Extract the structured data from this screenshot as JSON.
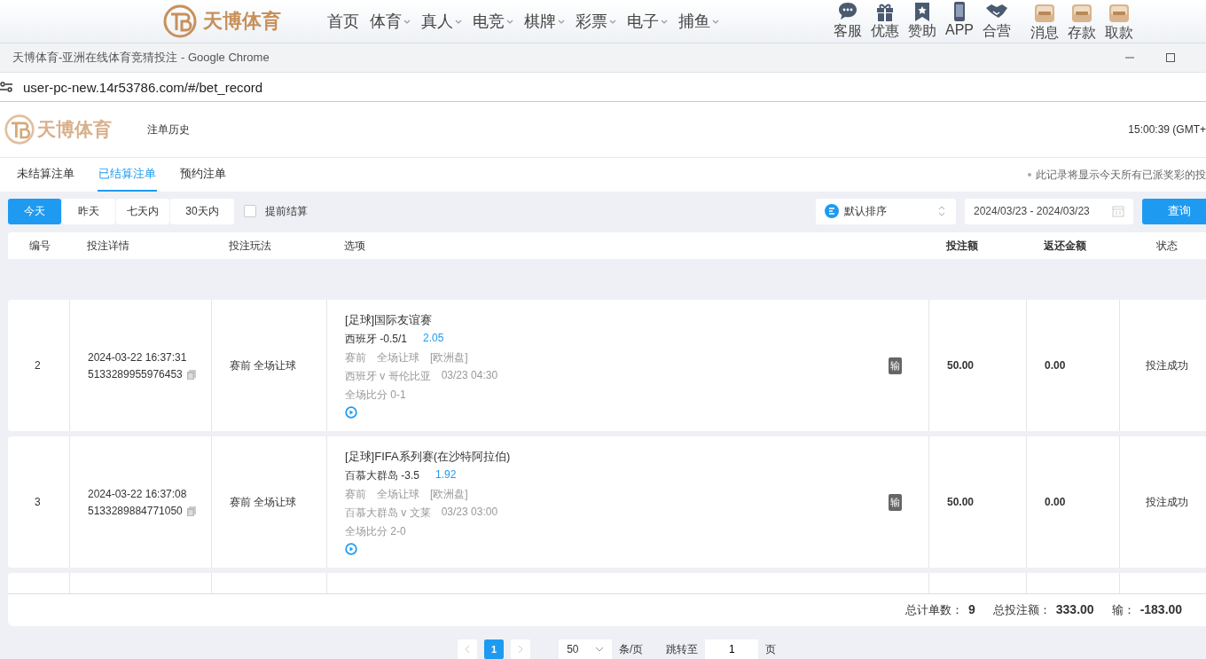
{
  "site_nav": {
    "brand": "天博体育",
    "menu": [
      {
        "label": "首页",
        "dropdown": false
      },
      {
        "label": "体育",
        "dropdown": true
      },
      {
        "label": "真人",
        "dropdown": true
      },
      {
        "label": "电竞",
        "dropdown": true
      },
      {
        "label": "棋牌",
        "dropdown": true
      },
      {
        "label": "彩票",
        "dropdown": true
      },
      {
        "label": "电子",
        "dropdown": true
      },
      {
        "label": "捕鱼",
        "dropdown": true
      }
    ],
    "shortcuts": [
      {
        "label": "客服"
      },
      {
        "label": "优惠"
      },
      {
        "label": "赞助"
      },
      {
        "label": "APP"
      },
      {
        "label": "合营"
      },
      {
        "label": "消息"
      },
      {
        "label": "存款"
      },
      {
        "label": "取款"
      }
    ]
  },
  "browser": {
    "title": "天博体育-亚洲在线体育竞猜投注 - Google Chrome",
    "url": "user-pc-new.14r53786.com/#/bet_record"
  },
  "header": {
    "brand": "天博体育",
    "title": "注单历史",
    "clock": "15:00:39 (GMT+"
  },
  "tabs": [
    {
      "label": "未结算注单",
      "selected": false
    },
    {
      "label": "已结算注单",
      "selected": true
    },
    {
      "label": "预约注单",
      "selected": false
    }
  ],
  "notice": "此记录将显示今天所有已派奖彩的投",
  "filters": {
    "ranges": [
      {
        "label": "今天",
        "selected": true
      },
      {
        "label": "昨天",
        "selected": false
      },
      {
        "label": "七天内",
        "selected": false
      },
      {
        "label": "30天内",
        "selected": false
      }
    ],
    "early_settle": {
      "label": "提前结算",
      "checked": false
    },
    "sort": "默认排序",
    "date_range": "2024/03/23 - 2024/03/23",
    "query_button": "查询"
  },
  "table": {
    "columns": [
      "编号",
      "投注详情",
      "投注玩法",
      "选项",
      "投注额",
      "返还金额",
      "状态"
    ],
    "rows": [
      {
        "no": "2",
        "time": "2024-03-22 16:37:31",
        "order_id": "5133289955976453",
        "play": "赛前 全场让球",
        "league": "[足球]国际友谊赛",
        "pick": "西班牙 -0.5/1",
        "odds": "2.05",
        "market": [
          "赛前",
          "全场让球",
          "[欧洲盘]"
        ],
        "match": "西班牙 v 哥伦比亚",
        "kickoff": "03/23 04:30",
        "score": "全场比分 0-1",
        "result": "输",
        "stake": "50.00",
        "payout": "0.00",
        "status": "投注成功"
      },
      {
        "no": "3",
        "time": "2024-03-22 16:37:08",
        "order_id": "5133289884771050",
        "play": "赛前 全场让球",
        "league": "[足球]FIFA系列赛(在沙特阿拉伯)",
        "pick": "百慕大群岛 -3.5",
        "odds": "1.92",
        "market": [
          "赛前",
          "全场让球",
          "[欧洲盘]"
        ],
        "match": "百慕大群岛 v 文莱",
        "kickoff": "03/23 03:00",
        "score": "全场比分 2-0",
        "result": "输",
        "stake": "50.00",
        "payout": "0.00",
        "status": "投注成功"
      }
    ]
  },
  "summary": [
    {
      "label": "总计单数：",
      "value": "9"
    },
    {
      "label": "总投注额：",
      "value": "333.00"
    },
    {
      "label": "输：",
      "value": "-183.00"
    }
  ],
  "pagination": {
    "pages": [
      {
        "label": "1",
        "selected": true
      }
    ],
    "page_size": "50",
    "page_size_unit": "条/页",
    "jump_label": "跳转至",
    "jump_value": "1",
    "page_suffix": "页"
  }
}
